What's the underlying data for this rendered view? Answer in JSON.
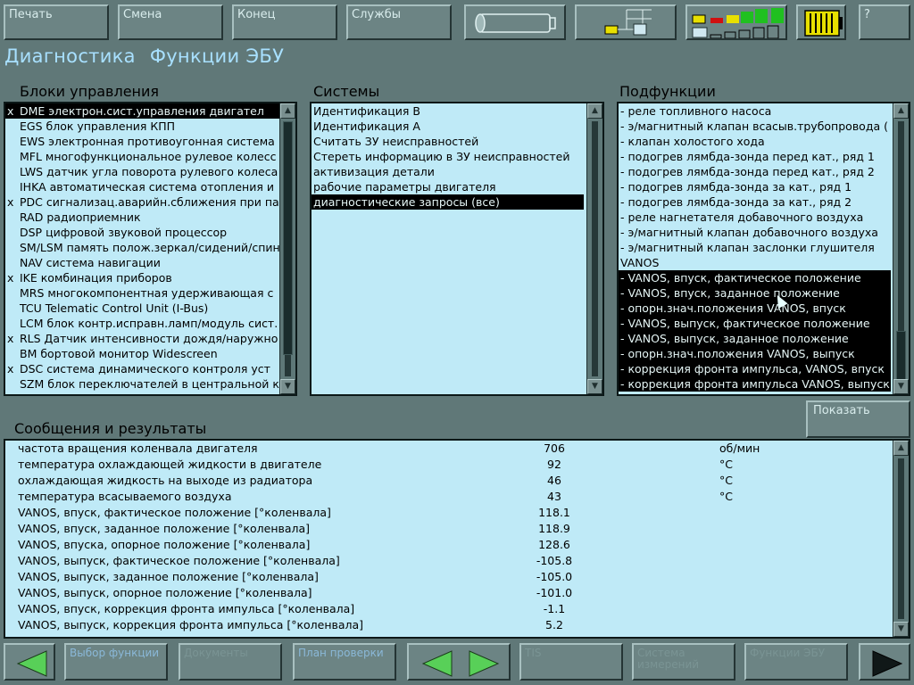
{
  "toolbar": {
    "print": "Печать",
    "shift": "Смена",
    "end": "Конец",
    "services": "Службы",
    "help": "?"
  },
  "title": {
    "part1": "Диагностика",
    "part2": "Функции ЭБУ"
  },
  "panels": {
    "units_header": "Блоки управления",
    "systems_header": "Системы",
    "subfunctions_header": "Подфункции",
    "messages_header": "Сообщения и результаты",
    "show_button": "Показать"
  },
  "units": [
    {
      "mark": "x",
      "label": "DME электрон.сист.управления двигател",
      "selected": true
    },
    {
      "mark": "",
      "label": "EGS блок управления КПП",
      "selected": false
    },
    {
      "mark": "",
      "label": "EWS электронная противоугонная система",
      "selected": false
    },
    {
      "mark": "",
      "label": "MFL многофункциональное рулевое колесс",
      "selected": false
    },
    {
      "mark": "",
      "label": "LWS датчик угла поворота рулевого колеса",
      "selected": false
    },
    {
      "mark": "",
      "label": "IHKA автоматическая система отопления и",
      "selected": false
    },
    {
      "mark": "x",
      "label": "PDC сигнализац.аварийн.сближения при па",
      "selected": false
    },
    {
      "mark": "",
      "label": "RAD радиоприемник",
      "selected": false
    },
    {
      "mark": "",
      "label": "DSP цифровой звуковой процессор",
      "selected": false
    },
    {
      "mark": "",
      "label": "SM/LSM память полож.зеркал/сидений/спин",
      "selected": false
    },
    {
      "mark": "",
      "label": "NAV система навигации",
      "selected": false
    },
    {
      "mark": "x",
      "label": "IKE комбинация приборов",
      "selected": false
    },
    {
      "mark": "",
      "label": "MRS многокомпонентная удерживающая с",
      "selected": false
    },
    {
      "mark": "",
      "label": "TCU Telematic Control Unit (I-Bus)",
      "selected": false
    },
    {
      "mark": "",
      "label": "LCM блок контр.исправн.ламп/модуль сист.",
      "selected": false
    },
    {
      "mark": "x",
      "label": "RLS Датчик интенсивности дождя/наружно",
      "selected": false
    },
    {
      "mark": "",
      "label": "BM бортовой монитор Widescreen",
      "selected": false
    },
    {
      "mark": "x",
      "label": "DSC система динамического контроля уст",
      "selected": false
    },
    {
      "mark": "",
      "label": "SZM блок переключателей в центральной к",
      "selected": false
    }
  ],
  "systems": [
    {
      "label": "Идентификация B",
      "selected": false
    },
    {
      "label": "Идентификация A",
      "selected": false
    },
    {
      "label": "Считать ЗУ неисправностей",
      "selected": false
    },
    {
      "label": "Стереть информацию в ЗУ неисправностей",
      "selected": false
    },
    {
      "label": "активизация детали",
      "selected": false
    },
    {
      "label": "рабочие параметры двигателя",
      "selected": false
    },
    {
      "label": "диагностические запросы (все)",
      "selected": true
    }
  ],
  "subfunctions": [
    {
      "label": "- реле топливного насоса",
      "selected": false
    },
    {
      "label": "- э/магнитный клапан всасыв.трубопровода (",
      "selected": false
    },
    {
      "label": "- клапан холостого хода",
      "selected": false
    },
    {
      "label": "- подогрев лямбда-зонда перед кат., ряд 1",
      "selected": false
    },
    {
      "label": "- подогрев лямбда-зонда перед кат., ряд 2",
      "selected": false
    },
    {
      "label": "- подогрев лямбда-зонда за кат., ряд 1",
      "selected": false
    },
    {
      "label": "- подогрев лямбда-зонда за кат., ряд 2",
      "selected": false
    },
    {
      "label": "- реле нагнетателя добавочного воздуха",
      "selected": false
    },
    {
      "label": "- э/магнитный клапан добавочного воздуха",
      "selected": false
    },
    {
      "label": "- э/магнитный клапан заслонки глушителя",
      "selected": false
    },
    {
      "label": "VANOS",
      "selected": false
    },
    {
      "label": "- VANOS, впуск, фактическое положение",
      "selected": true
    },
    {
      "label": "- VANOS, впуск, заданное положение",
      "selected": true
    },
    {
      "label": "- опорн.знач.положения VANOS, впуск",
      "selected": true
    },
    {
      "label": "- VANOS, выпуск, фактическое положение",
      "selected": true
    },
    {
      "label": "- VANOS, выпуск, заданное положение",
      "selected": true
    },
    {
      "label": "- опорн.знач.положения VANOS, выпуск",
      "selected": true
    },
    {
      "label": "- коррекция фронта импульса, VANOS, впуск",
      "selected": true
    },
    {
      "label": "- коррекция фронта импульса VANOS, выпуск",
      "selected": true
    }
  ],
  "messages": [
    {
      "name": "частота вращения коленвала двигателя",
      "value": "706",
      "unit": "об/мин"
    },
    {
      "name": "температура охлаждающей жидкости в двигателе",
      "value": "92",
      "unit": "°C"
    },
    {
      "name": "охлаждающая жидкость на выходе из радиатора",
      "value": "46",
      "unit": "°C"
    },
    {
      "name": "температура всасываемого воздуха",
      "value": "43",
      "unit": "°C"
    },
    {
      "name": "VANOS, впуск, фактическое положение [°коленвала]",
      "value": "118.1",
      "unit": ""
    },
    {
      "name": "VANOS, впуск, заданное положение [°коленвала]",
      "value": "118.9",
      "unit": ""
    },
    {
      "name": "VANOS, впуска, опорное положение [°коленвала]",
      "value": "128.6",
      "unit": ""
    },
    {
      "name": "VANOS, выпуск, фактическое положение [°коленвала]",
      "value": "-105.8",
      "unit": ""
    },
    {
      "name": "VANOS, выпуск, заданное положение [°коленвала]",
      "value": "-105.0",
      "unit": ""
    },
    {
      "name": "VANOS, выпуск, опорное положение [°коленвала]",
      "value": "-101.0",
      "unit": ""
    },
    {
      "name": "VANOS, впуск, коррекция фронта импульса [°коленвала]",
      "value": "-1.1",
      "unit": ""
    },
    {
      "name": "VANOS, выпуск, коррекция фронта импульса [°коленвала]",
      "value": "5.2",
      "unit": ""
    }
  ],
  "bottombar": {
    "select_function": "Выбор функции",
    "documents": "Документы",
    "test_plan": "План проверки",
    "tis": "TIS",
    "measurement_system": "Система измерений",
    "ecu_functions": "Функции ЭБУ"
  },
  "colors": {
    "background": "#607878",
    "list_bg": "#bfeaf7",
    "title": "#a8e0ff",
    "arrow_green": "#58d058",
    "selection": "#000000"
  }
}
